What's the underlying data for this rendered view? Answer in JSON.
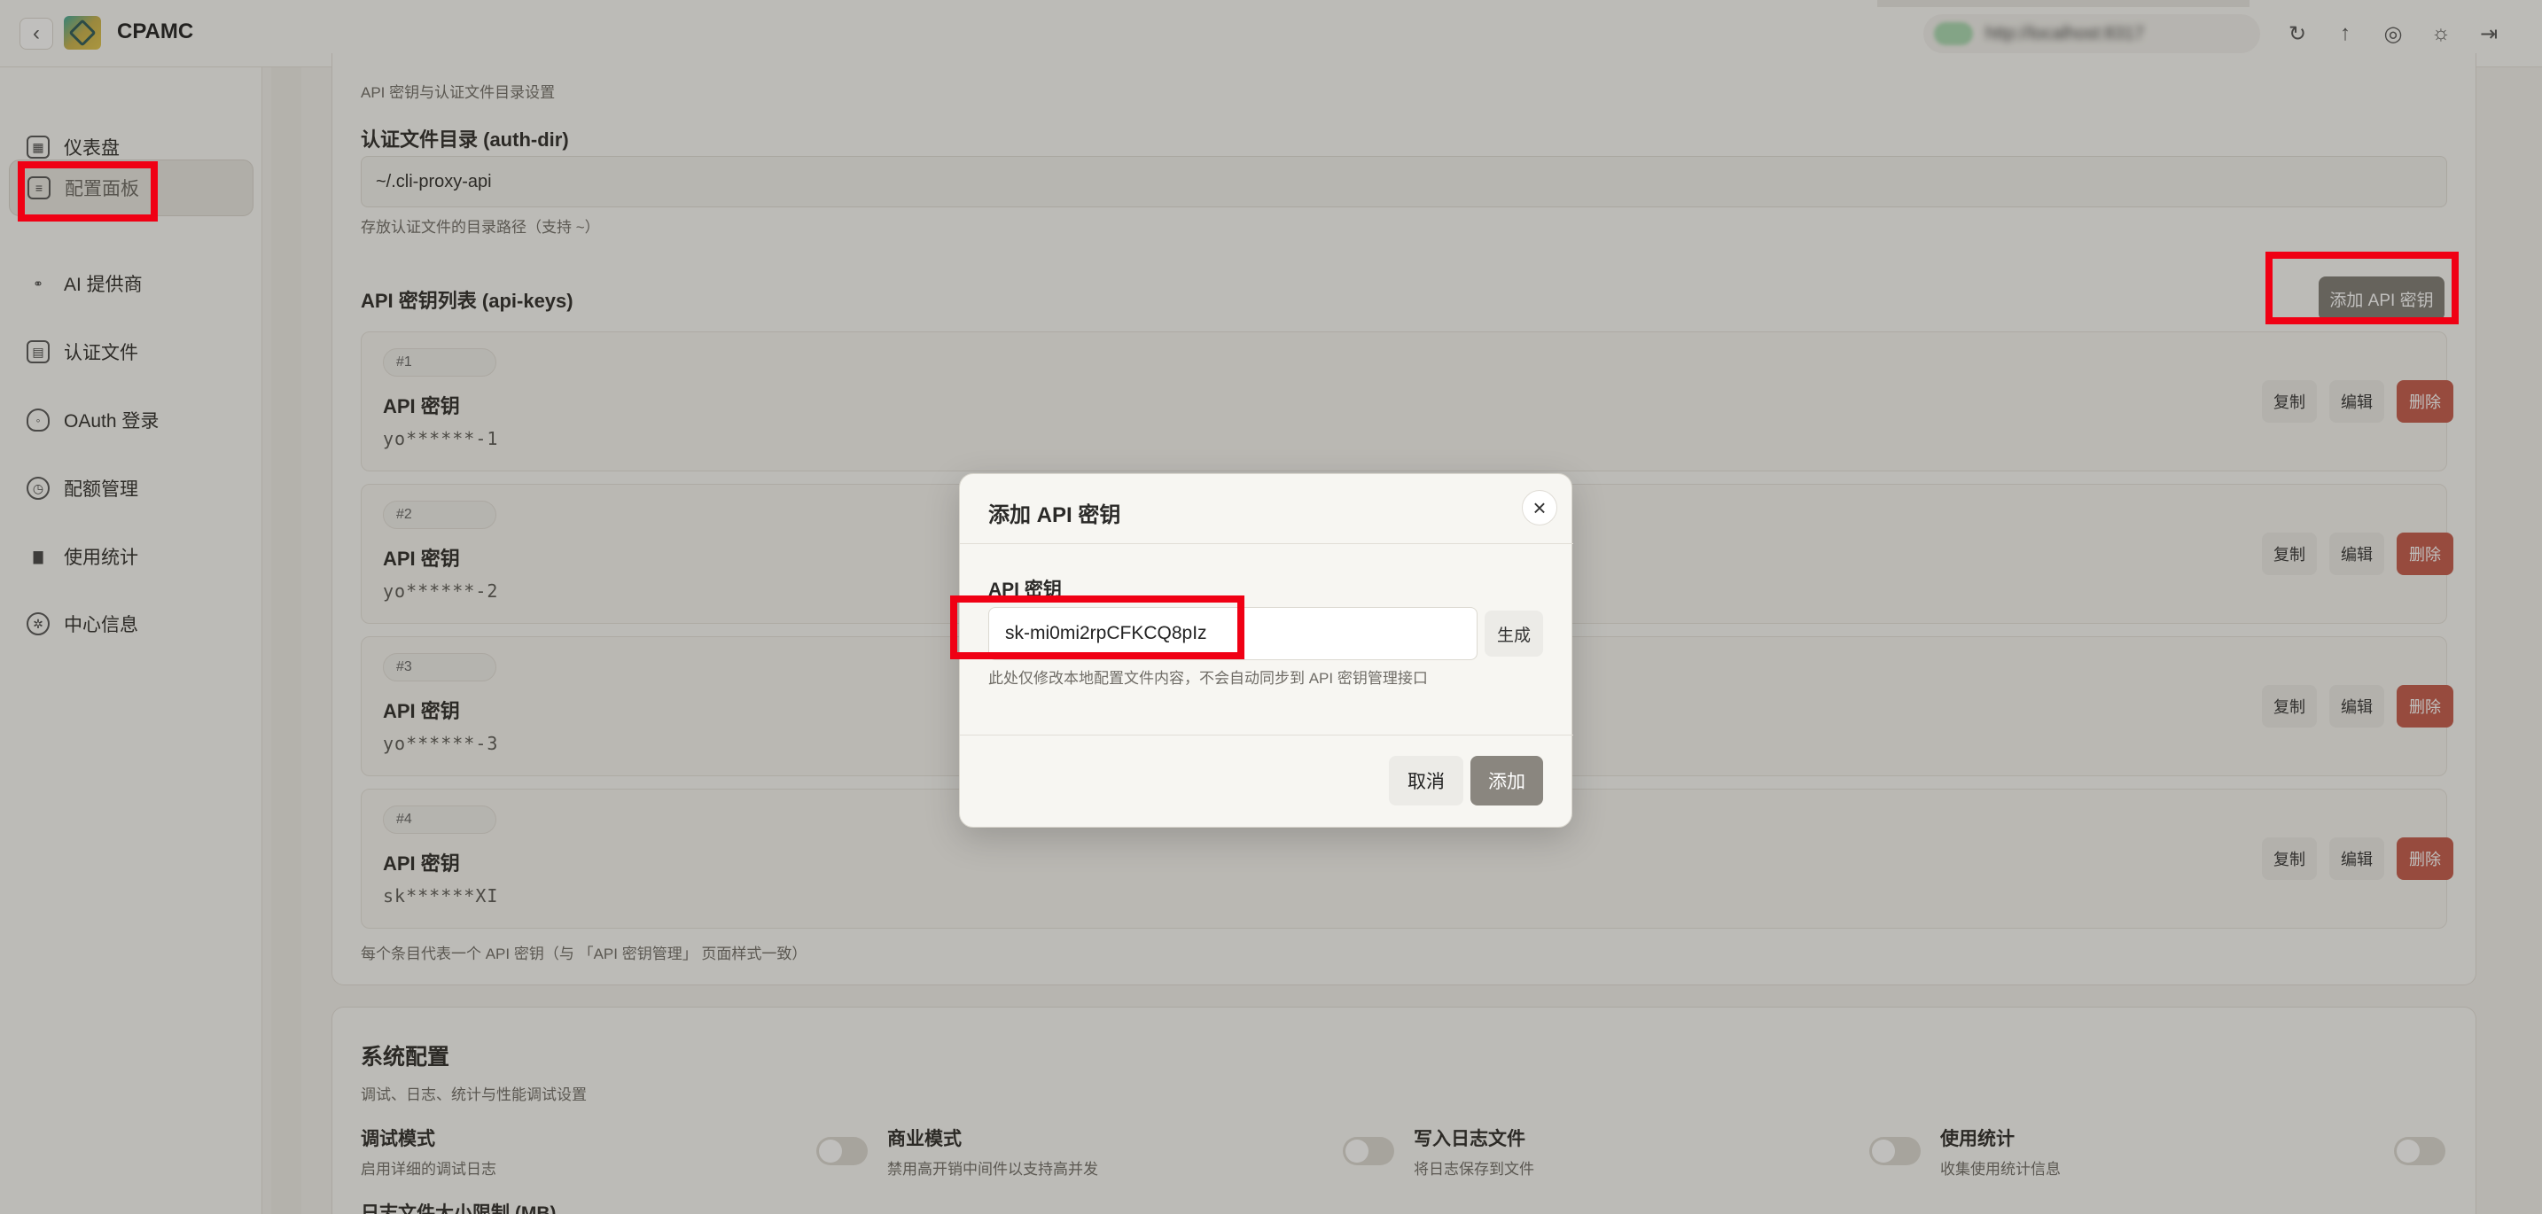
{
  "app": {
    "name": "CPAMC"
  },
  "topbar": {
    "connection_text": "http://localhost:8317"
  },
  "sidebar": {
    "items": [
      {
        "label": "仪表盘",
        "icon": "dashboard-icon"
      },
      {
        "label": "配置面板",
        "icon": "sliders-icon",
        "active": true
      },
      {
        "label": "AI 提供商",
        "icon": "provider-icon"
      },
      {
        "label": "认证文件",
        "icon": "file-icon"
      },
      {
        "label": "OAuth 登录",
        "icon": "shield-icon"
      },
      {
        "label": "配额管理",
        "icon": "clock-icon"
      },
      {
        "label": "使用统计",
        "icon": "bar-chart-icon"
      },
      {
        "label": "中心信息",
        "icon": "gear-icon"
      }
    ]
  },
  "api_section": {
    "subtitle": "API 密钥与认证文件目录设置",
    "auth_dir_label": "认证文件目录 (auth-dir)",
    "auth_dir_value": "~/.cli-proxy-api",
    "auth_dir_help": "存放认证文件的目录路径（支持 ~）",
    "keys_label": "API 密钥列表 (api-keys)",
    "add_key_label": "添加 API 密钥",
    "copy_label": "复制",
    "edit_label": "编辑",
    "delete_label": "删除",
    "keys": [
      {
        "badge": "#1",
        "title": "API 密钥",
        "value": "yo******-1"
      },
      {
        "badge": "#2",
        "title": "API 密钥",
        "value": "yo******-2"
      },
      {
        "badge": "#3",
        "title": "API 密钥",
        "value": "yo******-3"
      },
      {
        "badge": "#4",
        "title": "API 密钥",
        "value": "sk******XI"
      }
    ],
    "keys_footer": "每个条目代表一个 API 密钥（与 「API 密钥管理」 页面样式一致）"
  },
  "system_section": {
    "title": "系统配置",
    "subtitle": "调试、日志、统计与性能调试设置",
    "toggles": [
      {
        "label": "调试模式",
        "desc": "启用详细的调试日志",
        "on": false
      },
      {
        "label": "商业模式",
        "desc": "禁用高开销中间件以支持高并发",
        "on": false
      },
      {
        "label": "写入日志文件",
        "desc": "将日志保存到文件",
        "on": false
      },
      {
        "label": "使用统计",
        "desc": "收集使用统计信息",
        "on": false
      }
    ],
    "log_size_label": "日志文件大小限制 (MB)"
  },
  "modal": {
    "title": "添加 API 密钥",
    "field_label": "API 密钥",
    "field_value": "sk-mi0mi2rpCFKCQ8pIz",
    "generate_label": "生成",
    "help_text": "此处仅修改本地配置文件内容，不会自动同步到 API 密钥管理接口",
    "cancel_label": "取消",
    "confirm_label": "添加"
  },
  "colors": {
    "highlight": "#f00014",
    "danger": "#c45a4a",
    "primary": "#8a867f"
  }
}
